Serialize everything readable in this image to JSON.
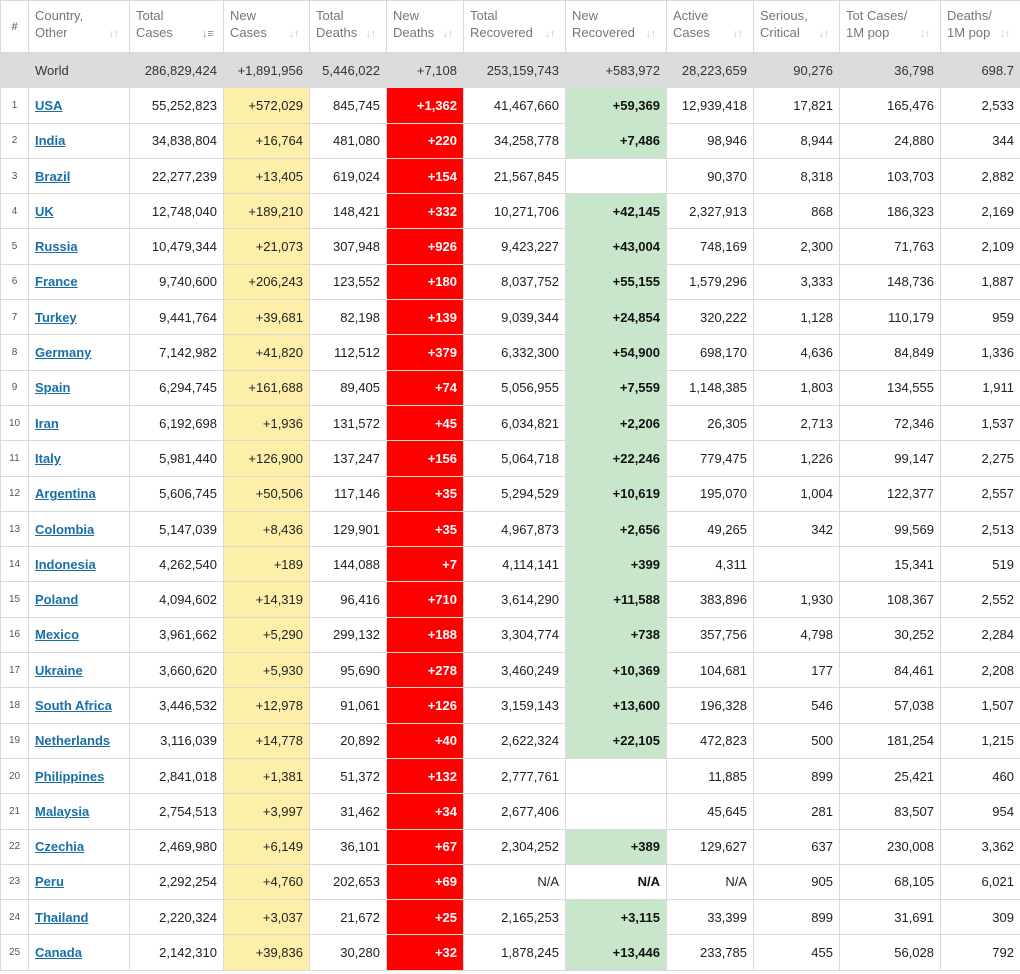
{
  "colors": {
    "header_text": "#777777",
    "world_row_bg": "#dcdcdc",
    "new_cases_bg": "#fdeeaa",
    "new_deaths_bg": "#ff0000",
    "new_recovered_bg": "#c8e6c9",
    "country_link": "#1a6fa8"
  },
  "table": {
    "columns": [
      {
        "line1": "#",
        "line2": "",
        "sort_icon": "none"
      },
      {
        "line1": "Country,",
        "line2": "Other",
        "sort_icon": "sort-both-icon"
      },
      {
        "line1": "Total",
        "line2": "Cases",
        "sort_icon": "sort-desc-icon"
      },
      {
        "line1": "New",
        "line2": "Cases",
        "sort_icon": "sort-both-icon"
      },
      {
        "line1": "Total",
        "line2": "Deaths",
        "sort_icon": "sort-both-icon"
      },
      {
        "line1": "New",
        "line2": "Deaths",
        "sort_icon": "sort-both-icon"
      },
      {
        "line1": "Total",
        "line2": "Recovered",
        "sort_icon": "sort-both-icon"
      },
      {
        "line1": "New",
        "line2": "Recovered",
        "sort_icon": "sort-both-icon"
      },
      {
        "line1": "Active",
        "line2": "Cases",
        "sort_icon": "sort-both-icon"
      },
      {
        "line1": "Serious,",
        "line2": "Critical",
        "sort_icon": "sort-both-icon"
      },
      {
        "line1": "Tot Cases/",
        "line2": "1M pop",
        "sort_icon": "sort-both-icon"
      },
      {
        "line1": "Deaths/",
        "line2": "1M pop",
        "sort_icon": "sort-both-icon"
      }
    ],
    "world": {
      "idx": "",
      "country": "World",
      "total_cases": "286,829,424",
      "new_cases": "+1,891,956",
      "total_deaths": "5,446,022",
      "new_deaths": "+7,108",
      "total_recovered": "253,159,743",
      "new_recovered": "+583,972",
      "active_cases": "28,223,659",
      "serious": "90,276",
      "cases_per_1m": "36,798",
      "deaths_per_1m": "698.7"
    },
    "rows": [
      {
        "idx": "1",
        "country": "USA",
        "total_cases": "55,252,823",
        "new_cases": "+572,029",
        "total_deaths": "845,745",
        "new_deaths": "+1,362",
        "total_recovered": "41,467,660",
        "new_recovered": "+59,369",
        "active_cases": "12,939,418",
        "serious": "17,821",
        "cases_per_1m": "165,476",
        "deaths_per_1m": "2,533"
      },
      {
        "idx": "2",
        "country": "India",
        "total_cases": "34,838,804",
        "new_cases": "+16,764",
        "total_deaths": "481,080",
        "new_deaths": "+220",
        "total_recovered": "34,258,778",
        "new_recovered": "+7,486",
        "active_cases": "98,946",
        "serious": "8,944",
        "cases_per_1m": "24,880",
        "deaths_per_1m": "344"
      },
      {
        "idx": "3",
        "country": "Brazil",
        "total_cases": "22,277,239",
        "new_cases": "+13,405",
        "total_deaths": "619,024",
        "new_deaths": "+154",
        "total_recovered": "21,567,845",
        "new_recovered": "",
        "active_cases": "90,370",
        "serious": "8,318",
        "cases_per_1m": "103,703",
        "deaths_per_1m": "2,882"
      },
      {
        "idx": "4",
        "country": "UK",
        "total_cases": "12,748,040",
        "new_cases": "+189,210",
        "total_deaths": "148,421",
        "new_deaths": "+332",
        "total_recovered": "10,271,706",
        "new_recovered": "+42,145",
        "active_cases": "2,327,913",
        "serious": "868",
        "cases_per_1m": "186,323",
        "deaths_per_1m": "2,169"
      },
      {
        "idx": "5",
        "country": "Russia",
        "total_cases": "10,479,344",
        "new_cases": "+21,073",
        "total_deaths": "307,948",
        "new_deaths": "+926",
        "total_recovered": "9,423,227",
        "new_recovered": "+43,004",
        "active_cases": "748,169",
        "serious": "2,300",
        "cases_per_1m": "71,763",
        "deaths_per_1m": "2,109"
      },
      {
        "idx": "6",
        "country": "France",
        "total_cases": "9,740,600",
        "new_cases": "+206,243",
        "total_deaths": "123,552",
        "new_deaths": "+180",
        "total_recovered": "8,037,752",
        "new_recovered": "+55,155",
        "active_cases": "1,579,296",
        "serious": "3,333",
        "cases_per_1m": "148,736",
        "deaths_per_1m": "1,887"
      },
      {
        "idx": "7",
        "country": "Turkey",
        "total_cases": "9,441,764",
        "new_cases": "+39,681",
        "total_deaths": "82,198",
        "new_deaths": "+139",
        "total_recovered": "9,039,344",
        "new_recovered": "+24,854",
        "active_cases": "320,222",
        "serious": "1,128",
        "cases_per_1m": "110,179",
        "deaths_per_1m": "959"
      },
      {
        "idx": "8",
        "country": "Germany",
        "total_cases": "7,142,982",
        "new_cases": "+41,820",
        "total_deaths": "112,512",
        "new_deaths": "+379",
        "total_recovered": "6,332,300",
        "new_recovered": "+54,900",
        "active_cases": "698,170",
        "serious": "4,636",
        "cases_per_1m": "84,849",
        "deaths_per_1m": "1,336"
      },
      {
        "idx": "9",
        "country": "Spain",
        "total_cases": "6,294,745",
        "new_cases": "+161,688",
        "total_deaths": "89,405",
        "new_deaths": "+74",
        "total_recovered": "5,056,955",
        "new_recovered": "+7,559",
        "active_cases": "1,148,385",
        "serious": "1,803",
        "cases_per_1m": "134,555",
        "deaths_per_1m": "1,911"
      },
      {
        "idx": "10",
        "country": "Iran",
        "total_cases": "6,192,698",
        "new_cases": "+1,936",
        "total_deaths": "131,572",
        "new_deaths": "+45",
        "total_recovered": "6,034,821",
        "new_recovered": "+2,206",
        "active_cases": "26,305",
        "serious": "2,713",
        "cases_per_1m": "72,346",
        "deaths_per_1m": "1,537"
      },
      {
        "idx": "11",
        "country": "Italy",
        "total_cases": "5,981,440",
        "new_cases": "+126,900",
        "total_deaths": "137,247",
        "new_deaths": "+156",
        "total_recovered": "5,064,718",
        "new_recovered": "+22,246",
        "active_cases": "779,475",
        "serious": "1,226",
        "cases_per_1m": "99,147",
        "deaths_per_1m": "2,275"
      },
      {
        "idx": "12",
        "country": "Argentina",
        "total_cases": "5,606,745",
        "new_cases": "+50,506",
        "total_deaths": "117,146",
        "new_deaths": "+35",
        "total_recovered": "5,294,529",
        "new_recovered": "+10,619",
        "active_cases": "195,070",
        "serious": "1,004",
        "cases_per_1m": "122,377",
        "deaths_per_1m": "2,557"
      },
      {
        "idx": "13",
        "country": "Colombia",
        "total_cases": "5,147,039",
        "new_cases": "+8,436",
        "total_deaths": "129,901",
        "new_deaths": "+35",
        "total_recovered": "4,967,873",
        "new_recovered": "+2,656",
        "active_cases": "49,265",
        "serious": "342",
        "cases_per_1m": "99,569",
        "deaths_per_1m": "2,513"
      },
      {
        "idx": "14",
        "country": "Indonesia",
        "total_cases": "4,262,540",
        "new_cases": "+189",
        "total_deaths": "144,088",
        "new_deaths": "+7",
        "total_recovered": "4,114,141",
        "new_recovered": "+399",
        "active_cases": "4,311",
        "serious": "",
        "cases_per_1m": "15,341",
        "deaths_per_1m": "519"
      },
      {
        "idx": "15",
        "country": "Poland",
        "total_cases": "4,094,602",
        "new_cases": "+14,319",
        "total_deaths": "96,416",
        "new_deaths": "+710",
        "total_recovered": "3,614,290",
        "new_recovered": "+11,588",
        "active_cases": "383,896",
        "serious": "1,930",
        "cases_per_1m": "108,367",
        "deaths_per_1m": "2,552"
      },
      {
        "idx": "16",
        "country": "Mexico",
        "total_cases": "3,961,662",
        "new_cases": "+5,290",
        "total_deaths": "299,132",
        "new_deaths": "+188",
        "total_recovered": "3,304,774",
        "new_recovered": "+738",
        "active_cases": "357,756",
        "serious": "4,798",
        "cases_per_1m": "30,252",
        "deaths_per_1m": "2,284"
      },
      {
        "idx": "17",
        "country": "Ukraine",
        "total_cases": "3,660,620",
        "new_cases": "+5,930",
        "total_deaths": "95,690",
        "new_deaths": "+278",
        "total_recovered": "3,460,249",
        "new_recovered": "+10,369",
        "active_cases": "104,681",
        "serious": "177",
        "cases_per_1m": "84,461",
        "deaths_per_1m": "2,208"
      },
      {
        "idx": "18",
        "country": "South Africa",
        "total_cases": "3,446,532",
        "new_cases": "+12,978",
        "total_deaths": "91,061",
        "new_deaths": "+126",
        "total_recovered": "3,159,143",
        "new_recovered": "+13,600",
        "active_cases": "196,328",
        "serious": "546",
        "cases_per_1m": "57,038",
        "deaths_per_1m": "1,507"
      },
      {
        "idx": "19",
        "country": "Netherlands",
        "total_cases": "3,116,039",
        "new_cases": "+14,778",
        "total_deaths": "20,892",
        "new_deaths": "+40",
        "total_recovered": "2,622,324",
        "new_recovered": "+22,105",
        "active_cases": "472,823",
        "serious": "500",
        "cases_per_1m": "181,254",
        "deaths_per_1m": "1,215"
      },
      {
        "idx": "20",
        "country": "Philippines",
        "total_cases": "2,841,018",
        "new_cases": "+1,381",
        "total_deaths": "51,372",
        "new_deaths": "+132",
        "total_recovered": "2,777,761",
        "new_recovered": "",
        "active_cases": "11,885",
        "serious": "899",
        "cases_per_1m": "25,421",
        "deaths_per_1m": "460"
      },
      {
        "idx": "21",
        "country": "Malaysia",
        "total_cases": "2,754,513",
        "new_cases": "+3,997",
        "total_deaths": "31,462",
        "new_deaths": "+34",
        "total_recovered": "2,677,406",
        "new_recovered": "",
        "active_cases": "45,645",
        "serious": "281",
        "cases_per_1m": "83,507",
        "deaths_per_1m": "954"
      },
      {
        "idx": "22",
        "country": "Czechia",
        "total_cases": "2,469,980",
        "new_cases": "+6,149",
        "total_deaths": "36,101",
        "new_deaths": "+67",
        "total_recovered": "2,304,252",
        "new_recovered": "+389",
        "active_cases": "129,627",
        "serious": "637",
        "cases_per_1m": "230,008",
        "deaths_per_1m": "3,362"
      },
      {
        "idx": "23",
        "country": "Peru",
        "total_cases": "2,292,254",
        "new_cases": "+4,760",
        "total_deaths": "202,653",
        "new_deaths": "+69",
        "total_recovered": "N/A",
        "new_recovered": "N/A",
        "active_cases": "N/A",
        "serious": "905",
        "cases_per_1m": "68,105",
        "deaths_per_1m": "6,021"
      },
      {
        "idx": "24",
        "country": "Thailand",
        "total_cases": "2,220,324",
        "new_cases": "+3,037",
        "total_deaths": "21,672",
        "new_deaths": "+25",
        "total_recovered": "2,165,253",
        "new_recovered": "+3,115",
        "active_cases": "33,399",
        "serious": "899",
        "cases_per_1m": "31,691",
        "deaths_per_1m": "309"
      },
      {
        "idx": "25",
        "country": "Canada",
        "total_cases": "2,142,310",
        "new_cases": "+39,836",
        "total_deaths": "30,280",
        "new_deaths": "+32",
        "total_recovered": "1,878,245",
        "new_recovered": "+13,446",
        "active_cases": "233,785",
        "serious": "455",
        "cases_per_1m": "56,028",
        "deaths_per_1m": "792"
      }
    ]
  }
}
